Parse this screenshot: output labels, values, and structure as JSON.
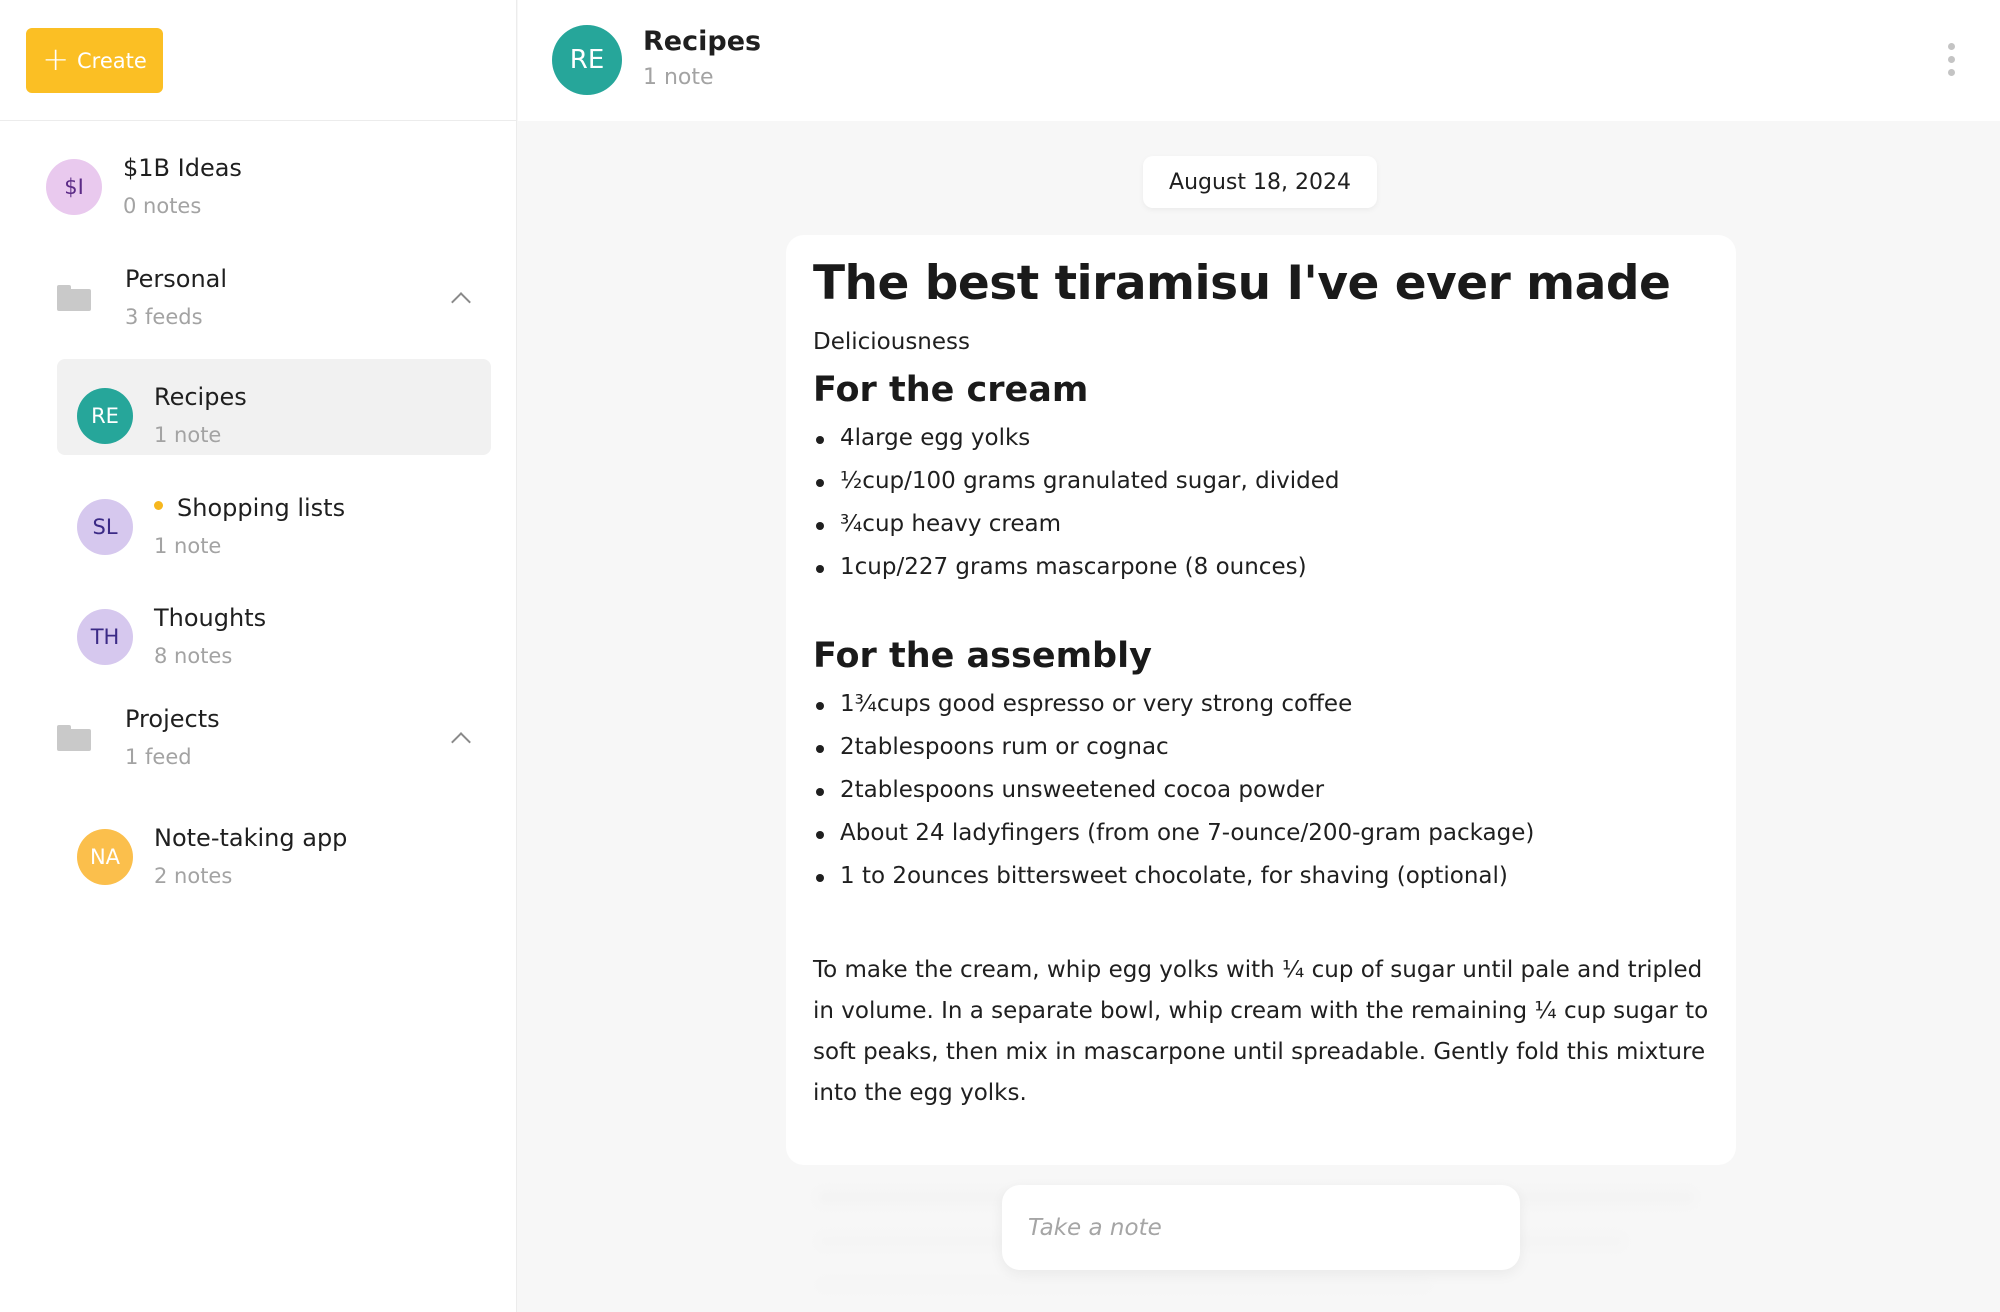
{
  "sidebar": {
    "create_label": "Create",
    "items": [
      {
        "initials": "$I",
        "title": "$1B Ideas",
        "subtitle": "0 notes",
        "avatar_bg": "#e9c9ee",
        "avatar_fg": "#5b2a86"
      },
      {
        "title": "Personal",
        "subtitle": "3 feeds",
        "folder": true,
        "expanded": true
      },
      {
        "initials": "RE",
        "title": "Recipes",
        "subtitle": "1 note",
        "avatar_bg": "#26a69a",
        "avatar_fg": "#ffffff",
        "selected": true
      },
      {
        "initials": "SL",
        "title": "Shopping lists",
        "subtitle": "1 note",
        "avatar_bg": "#d6c8ee",
        "avatar_fg": "#3b2a86",
        "unread": true
      },
      {
        "initials": "TH",
        "title": "Thoughts",
        "subtitle": "8 notes",
        "avatar_bg": "#d6c8ee",
        "avatar_fg": "#3b2a86"
      },
      {
        "title": "Projects",
        "subtitle": "1 feed",
        "folder": true,
        "expanded": true
      },
      {
        "initials": "NA",
        "title": "Note-taking app",
        "subtitle": "2 notes",
        "avatar_bg": "#fbbf4c",
        "avatar_fg": "#ffffff"
      }
    ]
  },
  "header": {
    "initials": "RE",
    "title": "Recipes",
    "subtitle": "1 note"
  },
  "date": "August 18, 2024",
  "note": {
    "title": "The best tiramisu I've ever made",
    "subtitle": "Deliciousness",
    "section1": "For the cream",
    "cream": [
      "4large egg yolks",
      "½cup/100 grams granulated sugar, divided",
      "¾cup heavy cream",
      "1cup/227 grams mascarpone (8 ounces)"
    ],
    "section2": "For the assembly",
    "assembly": [
      "1¾cups good espresso or very strong coffee",
      "2tablespoons rum or cognac",
      "2tablespoons unsweetened cocoa powder",
      "About 24 ladyfingers (from one 7-ounce/200-gram package)",
      "1 to 2ounces bittersweet chocolate, for shaving (optional)"
    ],
    "paragraph": "To make the cream, whip egg yolks with ¼ cup of sugar until pale and tripled in volume. In a separate bowl, whip cream with the remaining ¼ cup sugar to soft peaks, then mix in mascarpone until spreadable. Gently fold this mixture into the egg yolks."
  },
  "composer": {
    "placeholder": "Take a note"
  },
  "colors": {
    "accent": "#fbbf24",
    "selected_bg": "#f1f1f1",
    "unread_dot": "#f6b71e"
  }
}
